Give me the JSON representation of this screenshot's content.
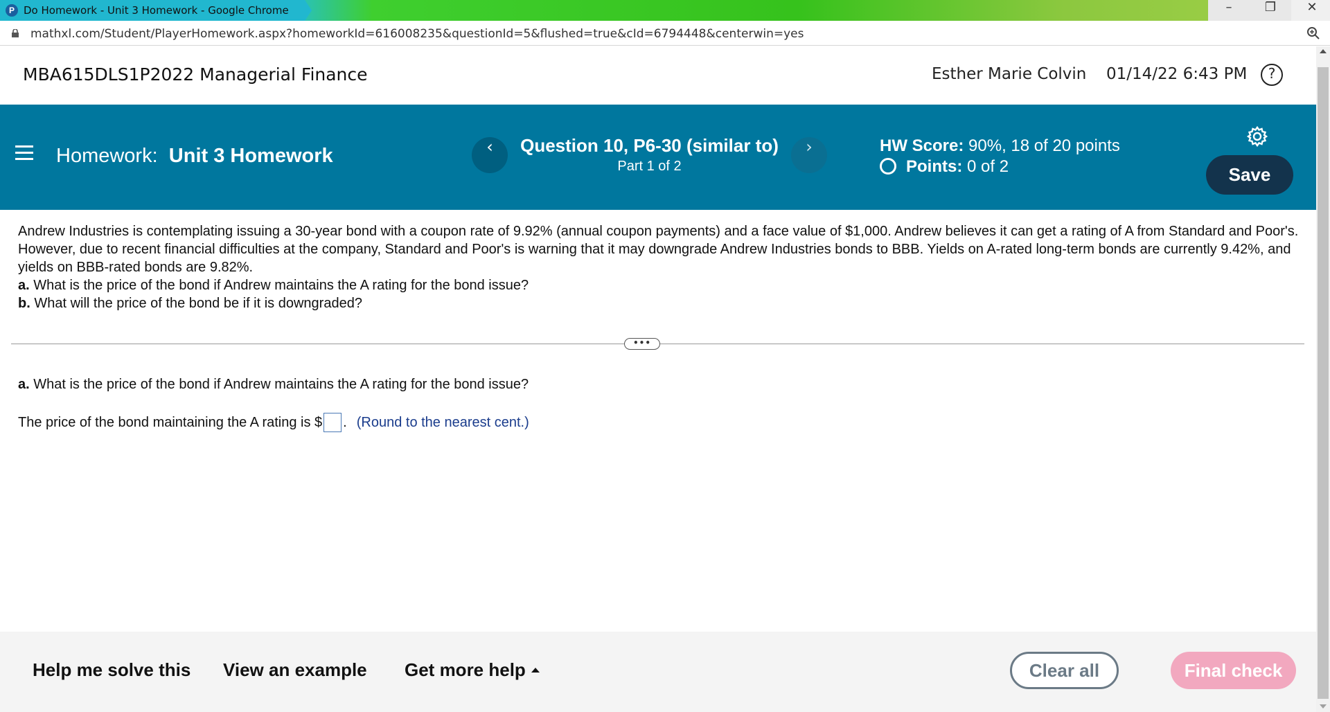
{
  "browser": {
    "window_title": "Do Homework - Unit 3 Homework - Google Chrome",
    "tab_icon_letter": "P",
    "url": "mathxl.com/Student/PlayerHomework.aspx?homeworkId=616008235&questionId=5&flushed=true&cId=6794448&centerwin=yes",
    "minimize_glyph": "–",
    "maximize_glyph": "❐",
    "close_glyph": "✕"
  },
  "header": {
    "course_title": "MBA615DLS1P2022 Managerial Finance",
    "user_name": "Esther Marie Colvin",
    "datetime": "01/14/22 6:43 PM",
    "help_glyph": "?"
  },
  "banner": {
    "homework_prefix": "Homework:",
    "homework_name": "Unit 3 Homework",
    "prev_glyph": "‹",
    "next_glyph": "›",
    "question_title": "Question 10, P6-30 (similar to)",
    "question_part": "Part 1 of 2",
    "hw_score_label": "HW Score:",
    "hw_score_value": "90%, 18 of 20 points",
    "points_label": "Points:",
    "points_value": "0 of 2",
    "save_label": "Save"
  },
  "problem": {
    "statement": "Andrew Industries is contemplating issuing a 30-year bond with a coupon rate of 9.92% (annual coupon payments) and a face value of $1,000. Andrew believes it can get a rating of A from Standard and Poor's. However, due to recent financial difficulties at the company, Standard and Poor's is warning that it may downgrade Andrew Industries bonds to BBB.  Yields on A-rated long-term bonds are currently 9.42%, and yields on BBB-rated bonds are 9.82%.",
    "part_a_label": "a.",
    "part_a_text": "What is the price of the bond if Andrew maintains the A rating for the bond issue?",
    "part_b_label": "b.",
    "part_b_text": "What will the price of the bond be if it is downgraded?"
  },
  "divider": {
    "handle_glyph": "•••"
  },
  "answer": {
    "question_label": "a.",
    "question_text": "What is the price of the bond if Andrew maintains the A rating for the bond issue?",
    "prefix": "The price of the bond maintaining the A rating is $",
    "suffix": ".",
    "input_value": "",
    "hint": "(Round to the nearest cent.)"
  },
  "bottom_bar": {
    "help_me_solve": "Help me solve this",
    "view_example": "View an example",
    "get_more_help": "Get more help",
    "clear_all": "Clear all",
    "final_check": "Final check"
  },
  "colors": {
    "banner_blue": "#00779e",
    "save_navy": "#13334c",
    "final_check_pink": "#f2a8bf",
    "hint_blue": "#1a3c8c"
  }
}
